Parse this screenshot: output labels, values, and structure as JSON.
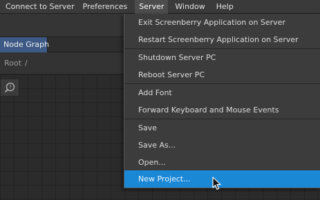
{
  "menubar": {
    "items": [
      "Connect to Server",
      "Preferences",
      "Server",
      "Window",
      "Help"
    ],
    "active_index": 2
  },
  "tabs": [
    {
      "label": "Node Graph",
      "selected": true
    }
  ],
  "breadcrumb": {
    "root": "Root",
    "separator": "/"
  },
  "canvas": {
    "help_icon": "help-search-icon"
  },
  "server_menu": {
    "groups": [
      [
        "Exit Screenberry Application on Server",
        "Restart Screenberry Application on Server"
      ],
      [
        "Shutdown Server PC",
        "Reboot Server PC"
      ],
      [
        "Add Font",
        "Forward Keyboard and Mouse Events"
      ],
      [
        "Save",
        "Save As...",
        "Open...",
        "New Project..."
      ]
    ],
    "highlighted_item": "New Project..."
  },
  "colors": {
    "menubar_bg": "#3a3a3a",
    "tab_selected": "#3d5a86",
    "menu_bg": "#3c3c3c",
    "menu_highlight": "#1b88d6",
    "canvas_bg": "#2b2b2b"
  },
  "cursor_icon": "arrow-pointer-icon"
}
